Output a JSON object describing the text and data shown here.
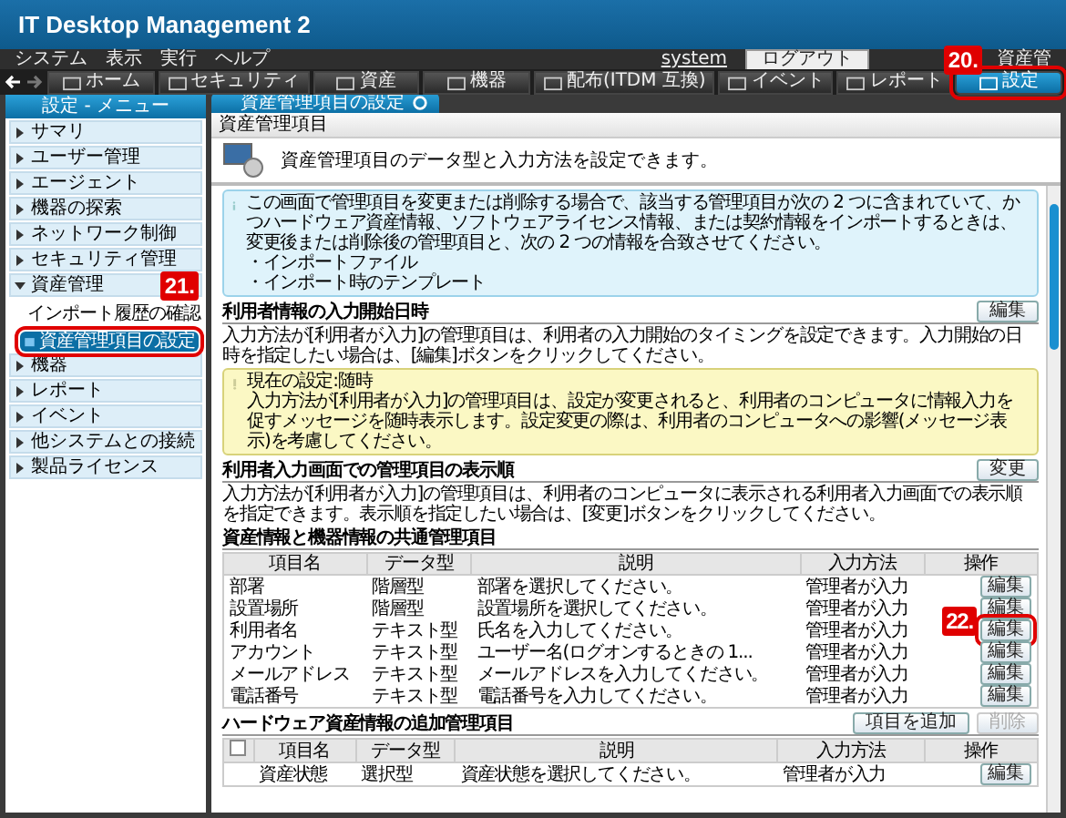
{
  "app_title": "IT Desktop Management 2",
  "menu": [
    "システム",
    "表示",
    "実行",
    "ヘルプ"
  ],
  "account": {
    "user": "system",
    "logout": "ログアウト",
    "role": "資産管"
  },
  "nav": [
    {
      "label": "ホーム",
      "selected": false
    },
    {
      "label": "セキュリティ",
      "selected": false
    },
    {
      "label": "資産",
      "selected": false
    },
    {
      "label": "機器",
      "selected": false
    },
    {
      "label": "配布(ITDM 互換)",
      "selected": false
    },
    {
      "label": "イベント",
      "selected": false
    },
    {
      "label": "レポート",
      "selected": false
    },
    {
      "label": "設定",
      "selected": true,
      "callout": "20."
    }
  ],
  "sidebar": {
    "title": "設定 - メニュー",
    "items": [
      {
        "label": "サマリ",
        "expanded": false
      },
      {
        "label": "ユーザー管理",
        "expanded": false
      },
      {
        "label": "エージェント",
        "expanded": false
      },
      {
        "label": "機器の探索",
        "expanded": false
      },
      {
        "label": "ネットワーク制御",
        "expanded": false
      },
      {
        "label": "セキュリティ管理",
        "expanded": false
      },
      {
        "label": "資産管理",
        "expanded": true,
        "children": [
          {
            "label": "インポート履歴の確認",
            "selected": false
          },
          {
            "label": "資産管理項目の設定",
            "selected": true,
            "callout": "21."
          }
        ]
      },
      {
        "label": "機器",
        "expanded": false
      },
      {
        "label": "レポート",
        "expanded": false
      },
      {
        "label": "イベント",
        "expanded": false
      },
      {
        "label": "他システムとの接続",
        "expanded": false
      },
      {
        "label": "製品ライセンス",
        "expanded": false
      }
    ]
  },
  "main_tab": "資産管理項目の設定",
  "page": {
    "title": "資産管理項目",
    "description": "資産管理項目のデータ型と入力方法を設定できます。"
  },
  "notice": {
    "text": "この画面で管理項目を変更または削除する場合で、該当する管理項目が次の 2 つに含まれていて、かつハードウェア資産情報、ソフトウェアライセンス情報、または契約情報をインポートするときは、変更後または削除後の管理項目と、次の 2 つの情報を合致させてください。",
    "bullets": [
      "・インポートファイル",
      "・インポート時のテンプレート"
    ]
  },
  "sections": [
    {
      "kind": "setting",
      "title": "利用者情報の入力開始日時",
      "button": "編集",
      "text": "入力方法が[利用者が入力]の管理項目は、利用者の入力開始のタイミングを設定できます。入力開始の日時を指定したい場合は、[編集]ボタンをクリックしてください。",
      "warning": {
        "heading": "現在の設定:随時",
        "text": "入力方法が[利用者が入力]の管理項目は、設定が変更されると、利用者のコンピュータに情報入力を促すメッセージを随時表示します。設定変更の際は、利用者のコンピュータへの影響(メッセージ表示)を考慮してください。"
      }
    },
    {
      "kind": "setting",
      "title": "利用者入力画面での管理項目の表示順",
      "button": "変更",
      "text": "入力方法が[利用者が入力]の管理項目は、利用者のコンピュータに表示される利用者入力画面での表示順を指定できます。表示順を指定したい場合は、[変更]ボタンをクリックしてください。"
    },
    {
      "kind": "table",
      "title": "資産情報と機器情報の共通管理項目",
      "columns": [
        "項目名",
        "データ型",
        "説明",
        "入力方法",
        "操作"
      ],
      "rows": [
        {
          "cells": [
            "部署",
            "階層型",
            "部署を選択してください。",
            "管理者が入力"
          ],
          "button": "編集"
        },
        {
          "cells": [
            "設置場所",
            "階層型",
            "設置場所を選択してください。",
            "管理者が入力"
          ],
          "button": "編集"
        },
        {
          "cells": [
            "利用者名",
            "テキスト型",
            "氏名を入力してください。",
            "管理者が入力"
          ],
          "button": "編集",
          "callout": "22."
        },
        {
          "cells": [
            "アカウント",
            "テキスト型",
            "ユーザー名(ログオンするときの 1...",
            "管理者が入力"
          ],
          "button": "編集"
        },
        {
          "cells": [
            "メールアドレス",
            "テキスト型",
            "メールアドレスを入力してください。",
            "管理者が入力"
          ],
          "button": "編集"
        },
        {
          "cells": [
            "電話番号",
            "テキスト型",
            "電話番号を入力してください。",
            "管理者が入力"
          ],
          "button": "編集"
        }
      ]
    },
    {
      "kind": "table",
      "title": "ハードウェア資産情報の追加管理項目",
      "select_all_checked": false,
      "actions": [
        {
          "label": "項目を追加",
          "disabled": false
        },
        {
          "label": "削除",
          "disabled": true
        }
      ],
      "columns": [
        "項目名",
        "データ型",
        "説明",
        "入力方法",
        "操作"
      ],
      "rows": [
        {
          "cells": [
            "資産状態",
            "選択型",
            "資産状態を選択してください。",
            "管理者が入力"
          ],
          "button": "編集"
        }
      ]
    }
  ]
}
